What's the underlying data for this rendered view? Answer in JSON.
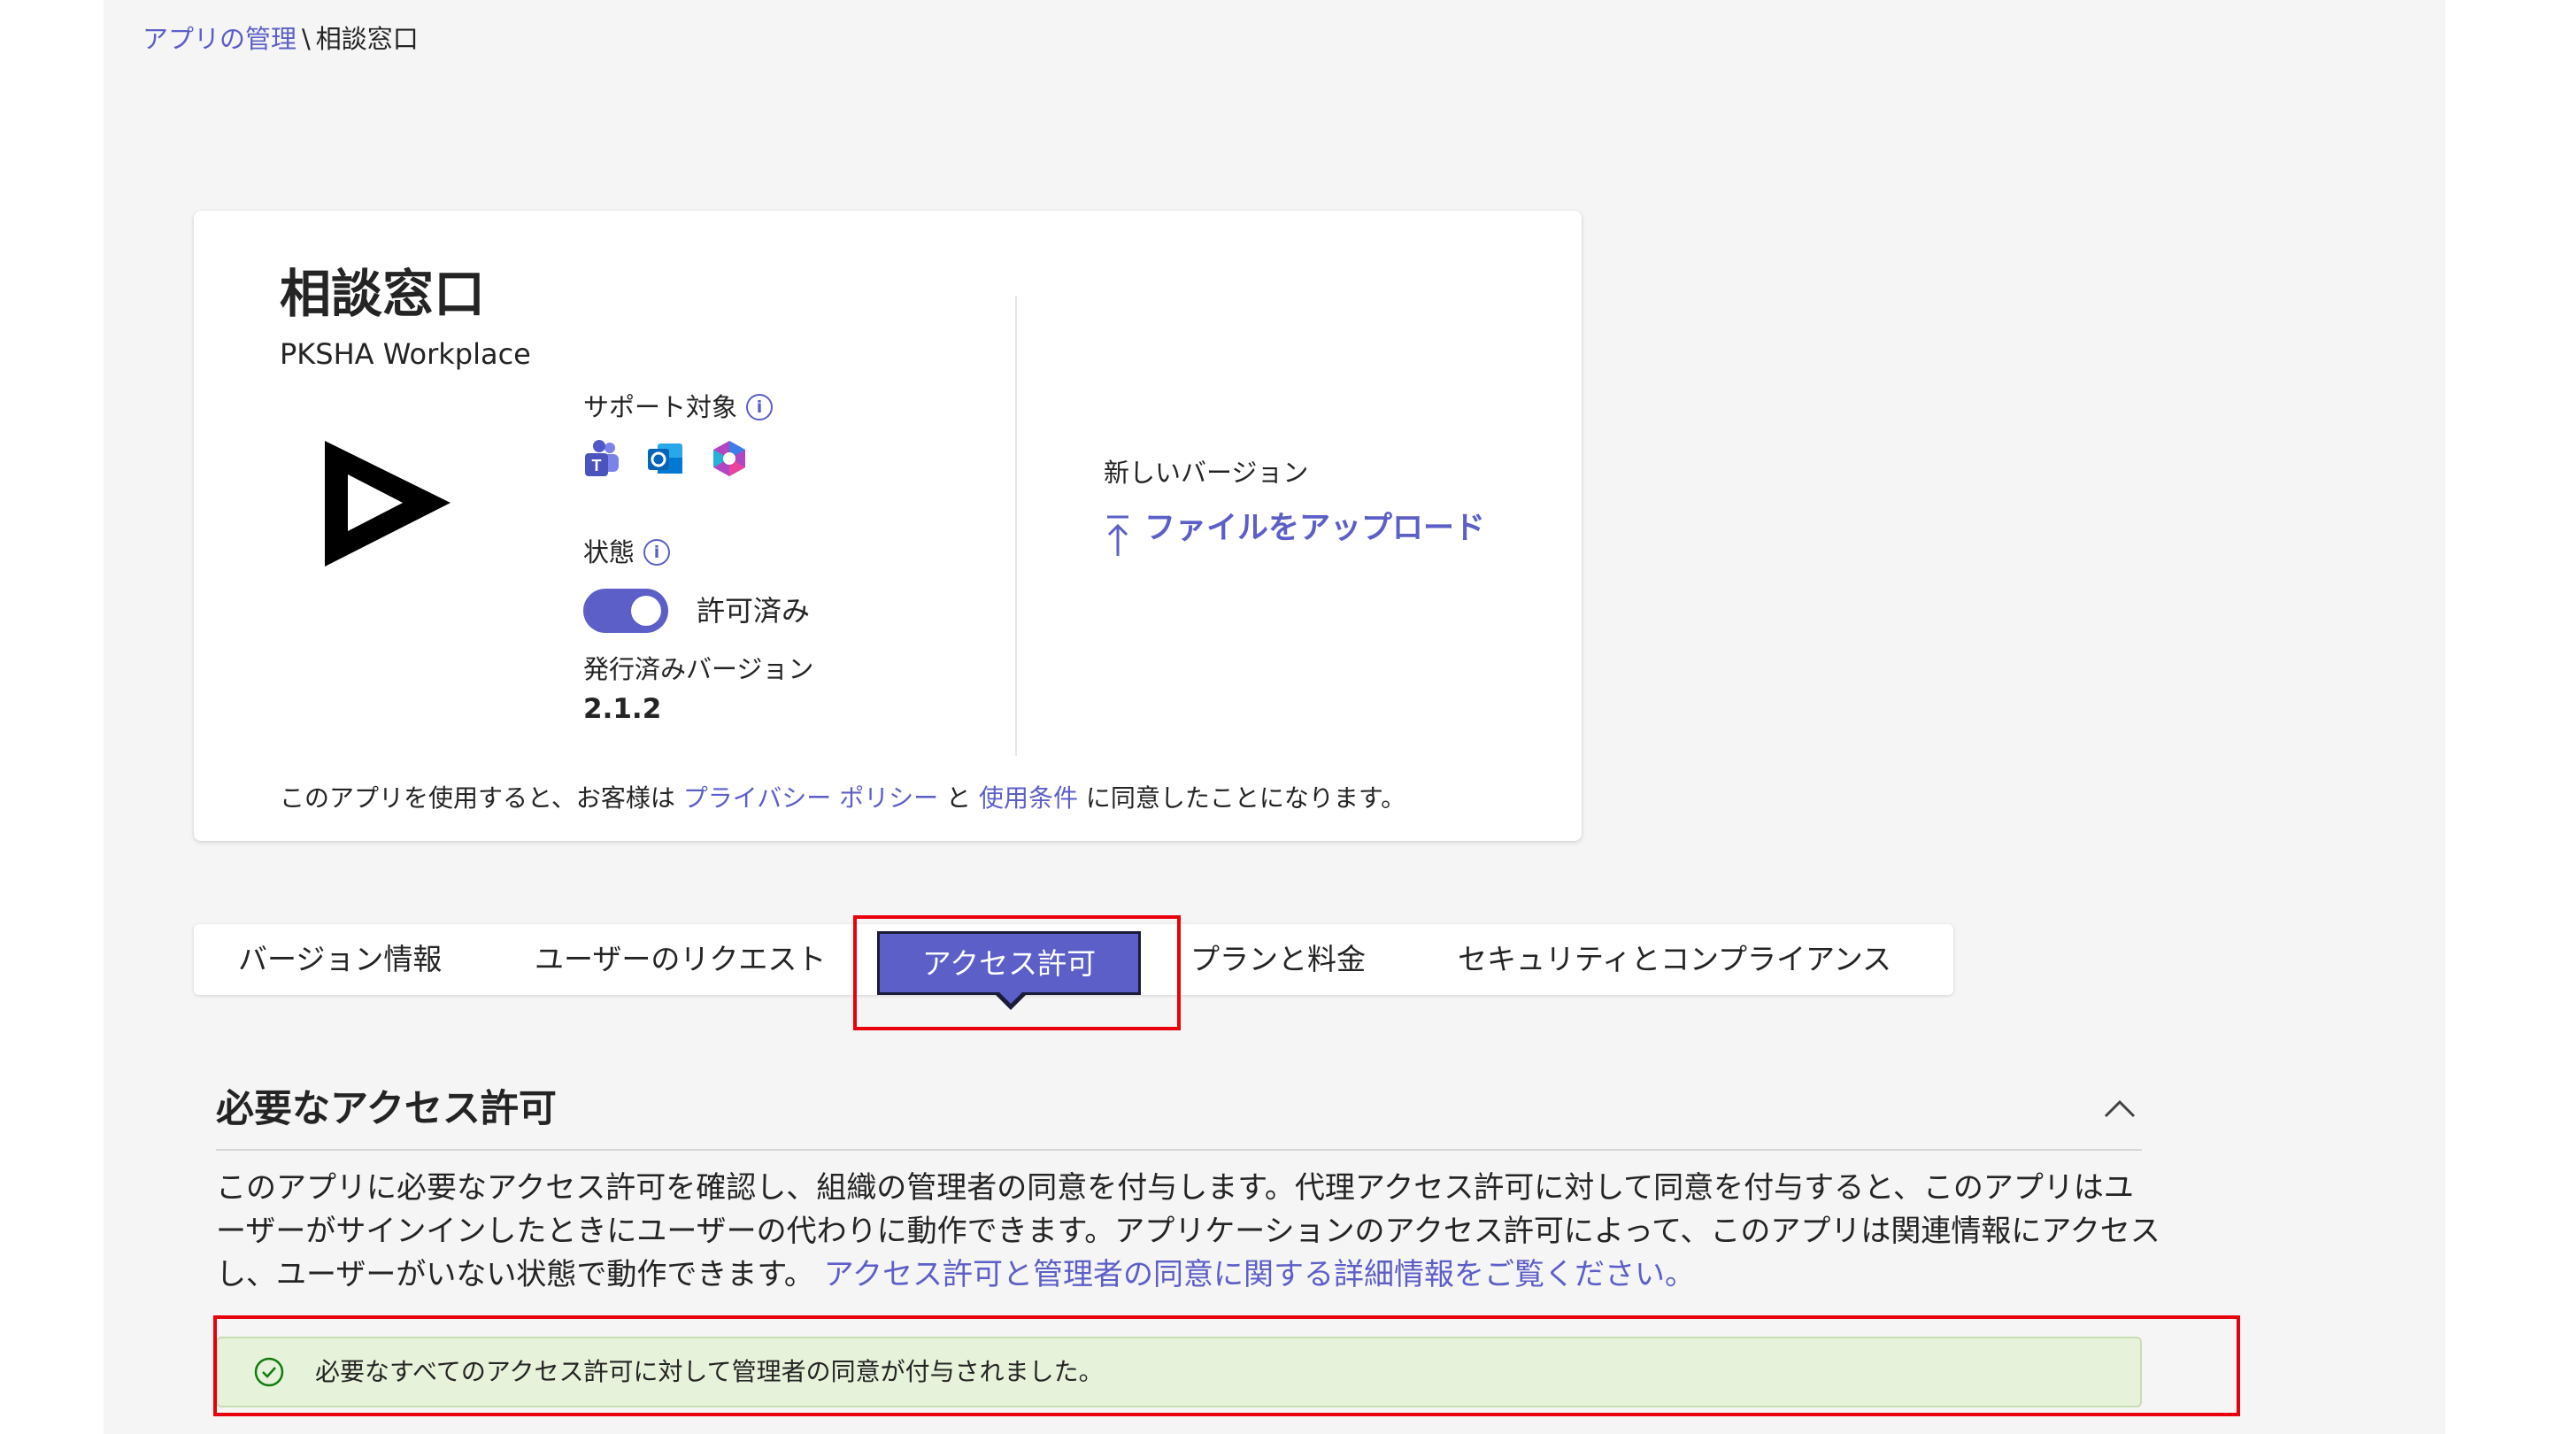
{
  "breadcrumb": {
    "parent": "アプリの管理",
    "separator": "\\",
    "current": "相談窓口"
  },
  "app": {
    "title": "相談窓口",
    "publisher": "PKSHA Workplace",
    "support_label": "サポート対象",
    "platforms": [
      "teams-icon",
      "outlook-icon",
      "microsoft-365-icon"
    ],
    "status_label": "状態",
    "status_value": "許可済み",
    "status_on": true,
    "published_version_label": "発行済みバージョン",
    "published_version": "2.1.2",
    "new_version_label": "新しいバージョン",
    "upload_label": "ファイルをアップロード",
    "consent_prefix": "このアプリを使用すると、お客様は",
    "privacy_link": "プライバシー ポリシー",
    "consent_and": "と",
    "terms_link": "使用条件",
    "consent_suffix": "に同意したことになります。"
  },
  "tabs": [
    {
      "label": "バージョン情報",
      "active": false
    },
    {
      "label": "ユーザーのリクエスト",
      "active": false
    },
    {
      "label": "アクセス許可",
      "active": true
    },
    {
      "label": "プランと料金",
      "active": false
    },
    {
      "label": "セキュリティとコンプライアンス",
      "active": false
    }
  ],
  "permissions": {
    "title": "必要なアクセス許可",
    "description": "このアプリに必要なアクセス許可を確認し、組織の管理者の同意を付与します。代理アクセス許可に対して同意を付与すると、このアプリはユーザーがサインインしたときにユーザーの代わりに動作できます。アプリケーションのアクセス許可によって、このアプリは関連情報にアクセスし、ユーザーがいない状態で動作できます。",
    "learn_more_link": "アクセス許可と管理者の同意に関する詳細情報をご覧ください。",
    "success_message": "必要なすべてのアクセス許可に対して管理者の同意が付与されました。"
  },
  "colors": {
    "accent": "#5b5fc7",
    "highlight": "#e8000b",
    "success_bg": "#e7f2da"
  }
}
